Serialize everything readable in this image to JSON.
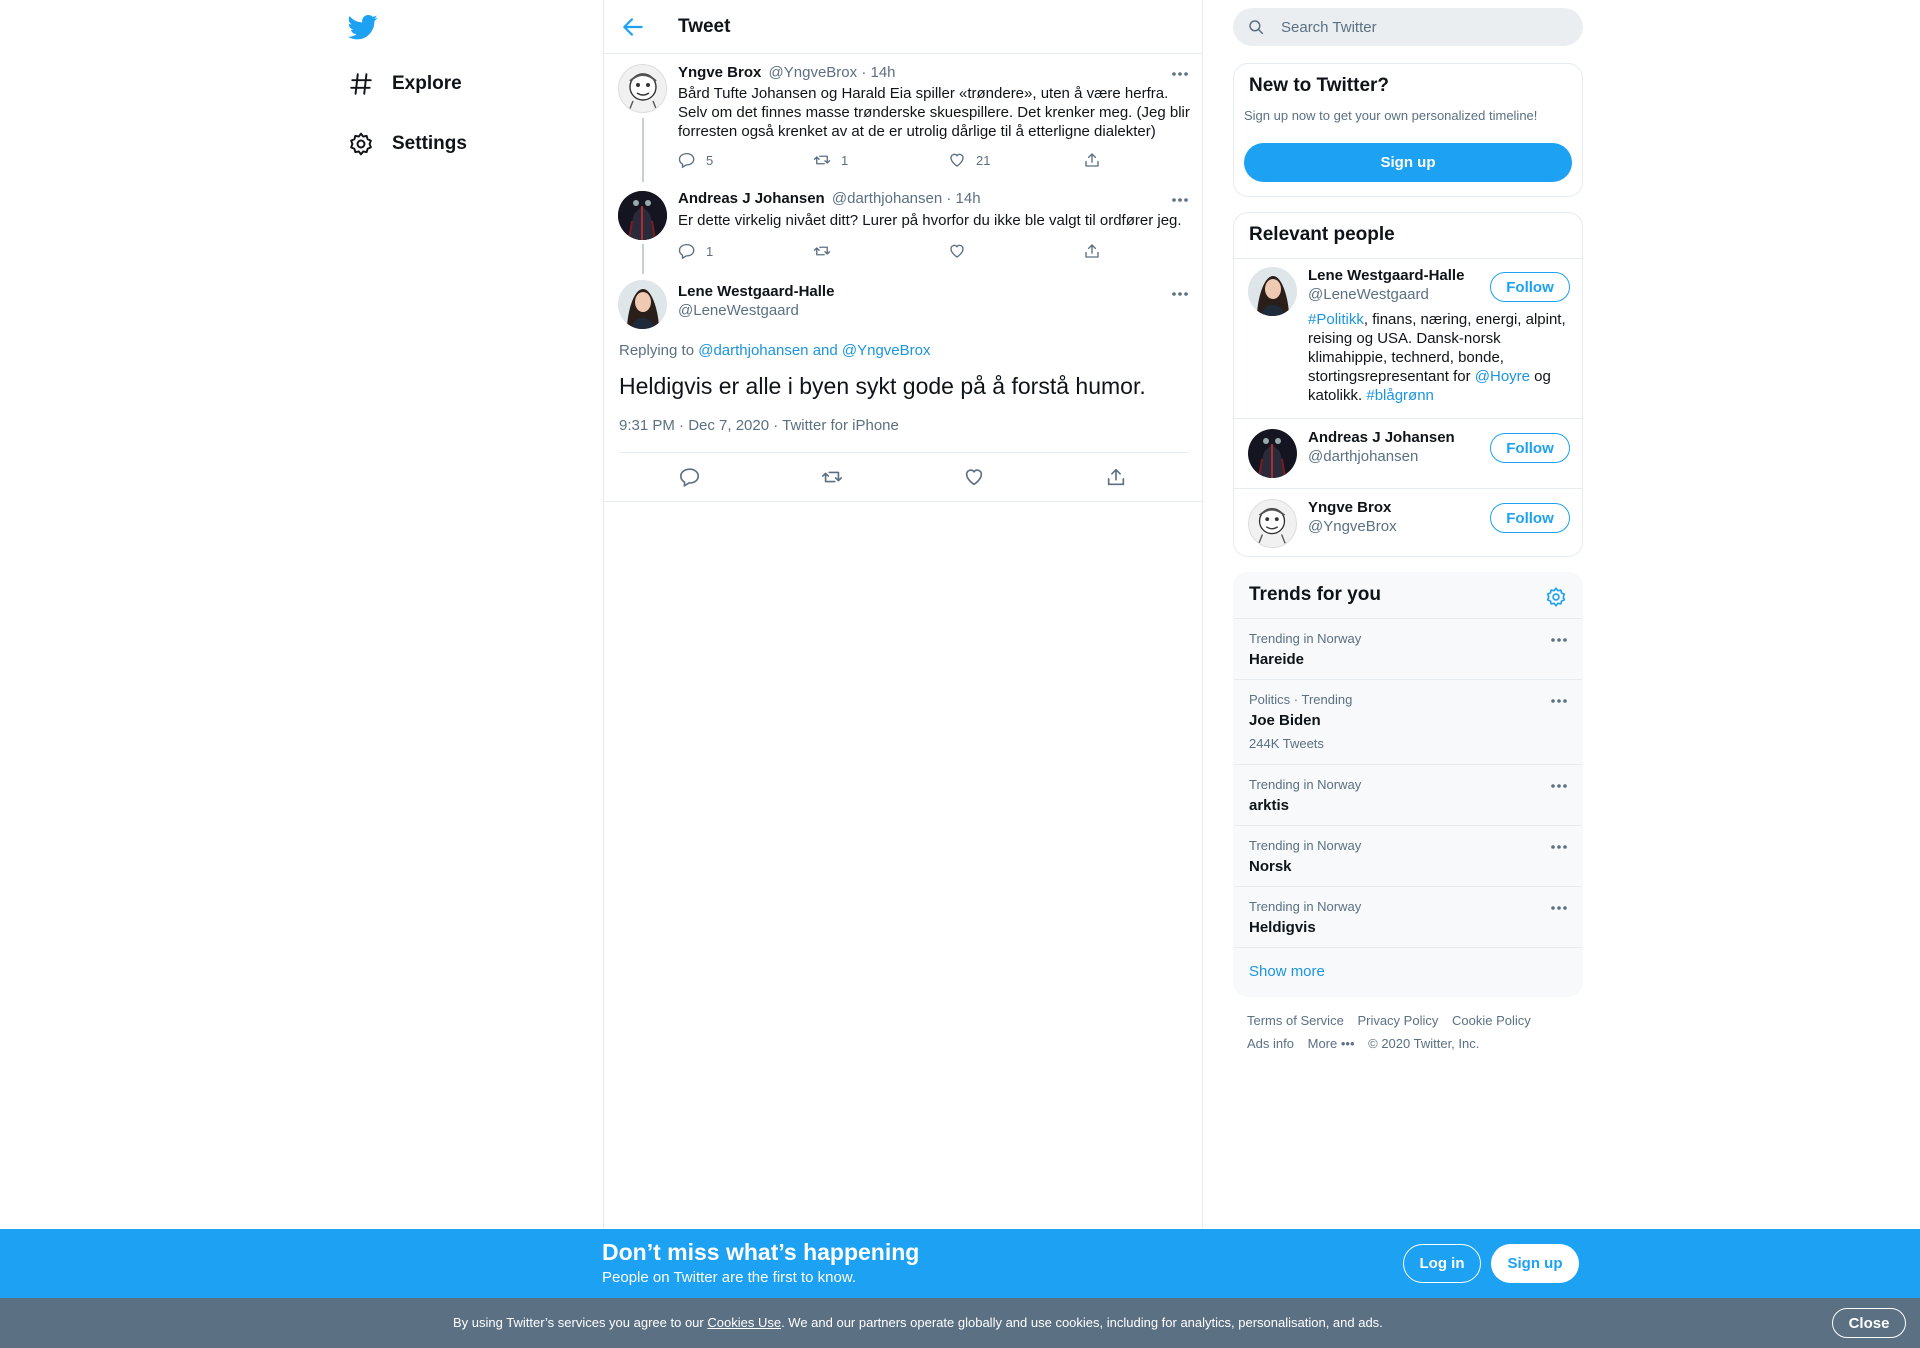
{
  "nav": {
    "logo": "twitter-bird-icon",
    "items": [
      {
        "label": "Explore",
        "icon": "hashtag-icon"
      },
      {
        "label": "Settings",
        "icon": "gear-icon"
      }
    ]
  },
  "main": {
    "header_title": "Tweet",
    "thread": [
      {
        "name": "Yngve Brox",
        "handle": "@YngveBrox",
        "time": "· 14h",
        "text": "Bård Tufte Johansen og Harald Eia spiller «trøndere», uten å være herfra. Selv om det finnes masse trønderske skuespillere. Det krenker meg. (Jeg blir forresten også krenket av at de er utrolig dårlige til å etterligne dialekter)",
        "replies": "5",
        "retweets": "1",
        "likes": "21"
      },
      {
        "name": "Andreas J Johansen",
        "handle": "@darthjohansen",
        "time": "· 14h",
        "text": "Er dette virkelig nivået ditt? Lurer på hvorfor du ikke ble valgt til ordfører jeg.",
        "replies": "1",
        "retweets": "",
        "likes": ""
      }
    ],
    "focus": {
      "name": "Lene Westgaard-Halle",
      "handle": "@LeneWestgaard",
      "replying_prefix": "Replying to ",
      "replying_to": "@darthjohansen and @YngveBrox",
      "text": "Heldigvis er alle i byen sykt gode på å forstå humor.",
      "timestamp": "9:31 PM · Dec 7, 2020 · Twitter for iPhone"
    }
  },
  "sidebar": {
    "search_placeholder": "Search Twitter",
    "new_to_twitter": {
      "title": "New to Twitter?",
      "subtitle": "Sign up now to get your own personalized timeline!",
      "button": "Sign up"
    },
    "relevant_people": {
      "title": "Relevant people",
      "follow_label": "Follow",
      "people": [
        {
          "name": "Lene Westgaard-Halle",
          "handle": "@LeneWestgaard",
          "bio_parts": [
            "#Politikk",
            ", finans, næring, energi, alpint, reising og USA. Dansk-norsk klimahippie, technerd, bonde, stortingsrepresentant for ",
            "@Hoyre",
            " og katolikk. ",
            "#blågrønn"
          ]
        },
        {
          "name": "Andreas J Johansen",
          "handle": "@darthjohansen"
        },
        {
          "name": "Yngve Brox",
          "handle": "@YngveBrox"
        }
      ]
    },
    "trends": {
      "title": "Trends for you",
      "items": [
        {
          "context": "Trending in Norway",
          "name": "Hareide",
          "count": ""
        },
        {
          "context": "Politics · Trending",
          "name": "Joe Biden",
          "count": "244K Tweets"
        },
        {
          "context": "Trending in Norway",
          "name": "arktis",
          "count": ""
        },
        {
          "context": "Trending in Norway",
          "name": "Norsk",
          "count": ""
        },
        {
          "context": "Trending in Norway",
          "name": "Heldigvis",
          "count": ""
        }
      ],
      "show_more": "Show more"
    },
    "footer": {
      "row1": [
        "Terms of Service",
        "Privacy Policy",
        "Cookie Policy"
      ],
      "row2": [
        "Ads info",
        "More •••",
        "© 2020 Twitter, Inc."
      ]
    }
  },
  "banner": {
    "title": "Don’t miss what’s happening",
    "subtitle": "People on Twitter are the first to know.",
    "login": "Log in",
    "signup": "Sign up"
  },
  "cookie": {
    "prefix": "By using Twitter’s services you agree to our ",
    "link": "Cookies Use",
    "suffix": ". We and our partners operate globally and use cookies, including for analytics, personalisation, and ads.",
    "close": "Close"
  },
  "colors": {
    "accent": "#1da1f2",
    "link": "#1b95e0",
    "secondary_text": "#5b7083",
    "cookie_bar": "#5b7083"
  }
}
